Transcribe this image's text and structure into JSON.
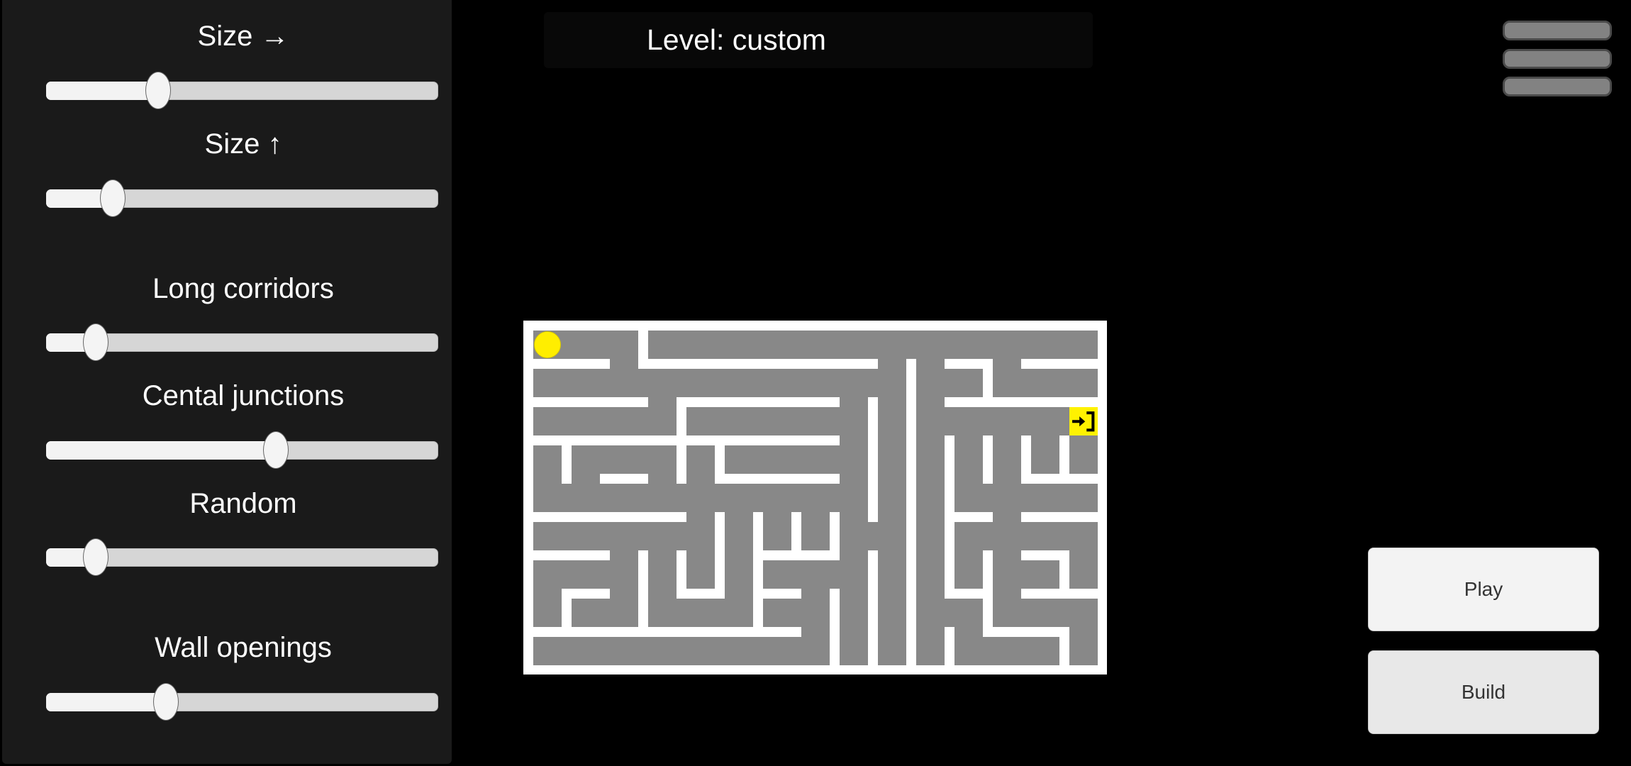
{
  "header": {
    "title": "Level: custom"
  },
  "menu": {
    "icon": "hamburger-menu-icon",
    "bar_count": 3
  },
  "settings_panel": {
    "sliders": [
      {
        "id": "size-horizontal",
        "label": "Size →",
        "value": 0.285
      },
      {
        "id": "size-vertical",
        "label": "Size ↑",
        "value": 0.17
      },
      {
        "id": "long-corridors",
        "label": "Long corridors",
        "value": 0.127
      },
      {
        "id": "cental-junctions",
        "label": "Cental junctions",
        "value": 0.585
      },
      {
        "id": "random",
        "label": "Random",
        "value": 0.127
      },
      {
        "id": "wall-openings",
        "label": "Wall openings",
        "value": 0.305
      }
    ]
  },
  "buttons": {
    "play": "Play",
    "build": "Build"
  },
  "colors": {
    "panel": "#1a1a1a",
    "maze_floor": "#888888",
    "maze_wall": "#ffffff",
    "player": "#ffee00",
    "exit": "#fff200"
  },
  "maze": {
    "columns": 15,
    "rows": 9,
    "player_cell": {
      "col": 0,
      "row": 0
    },
    "exit_cell": {
      "col": 14,
      "row": 2,
      "icon": "exit-door-icon"
    },
    "horizontal_walls": [
      [
        0,
        1,
        3,
        4,
        5,
        6,
        7,
        8,
        11,
        13,
        14
      ],
      [
        0,
        1,
        2,
        4,
        5,
        6,
        7,
        11,
        12,
        13,
        14
      ],
      [
        0,
        1,
        2,
        3,
        4,
        5,
        6,
        7
      ],
      [
        2,
        5,
        6,
        7,
        13,
        14
      ],
      [
        0,
        1,
        2,
        3,
        11,
        13,
        14
      ],
      [
        0,
        1,
        6,
        7,
        13
      ],
      [
        1,
        4,
        6,
        11,
        13,
        14
      ],
      [
        0,
        1,
        2,
        3,
        4,
        5,
        6,
        12,
        13
      ]
    ],
    "vertical_walls": [
      [
        2
      ],
      [
        9,
        11
      ],
      [
        3,
        8,
        9
      ],
      [
        0,
        3,
        4,
        8,
        9,
        10,
        11,
        12,
        13
      ],
      [
        8,
        9,
        10
      ],
      [
        4,
        5,
        6,
        7,
        9,
        10
      ],
      [
        2,
        3,
        4,
        5,
        8,
        9,
        10,
        11,
        13
      ],
      [
        0,
        2,
        5,
        7,
        8,
        9,
        11
      ],
      [
        7,
        8,
        9,
        10,
        13
      ]
    ]
  }
}
